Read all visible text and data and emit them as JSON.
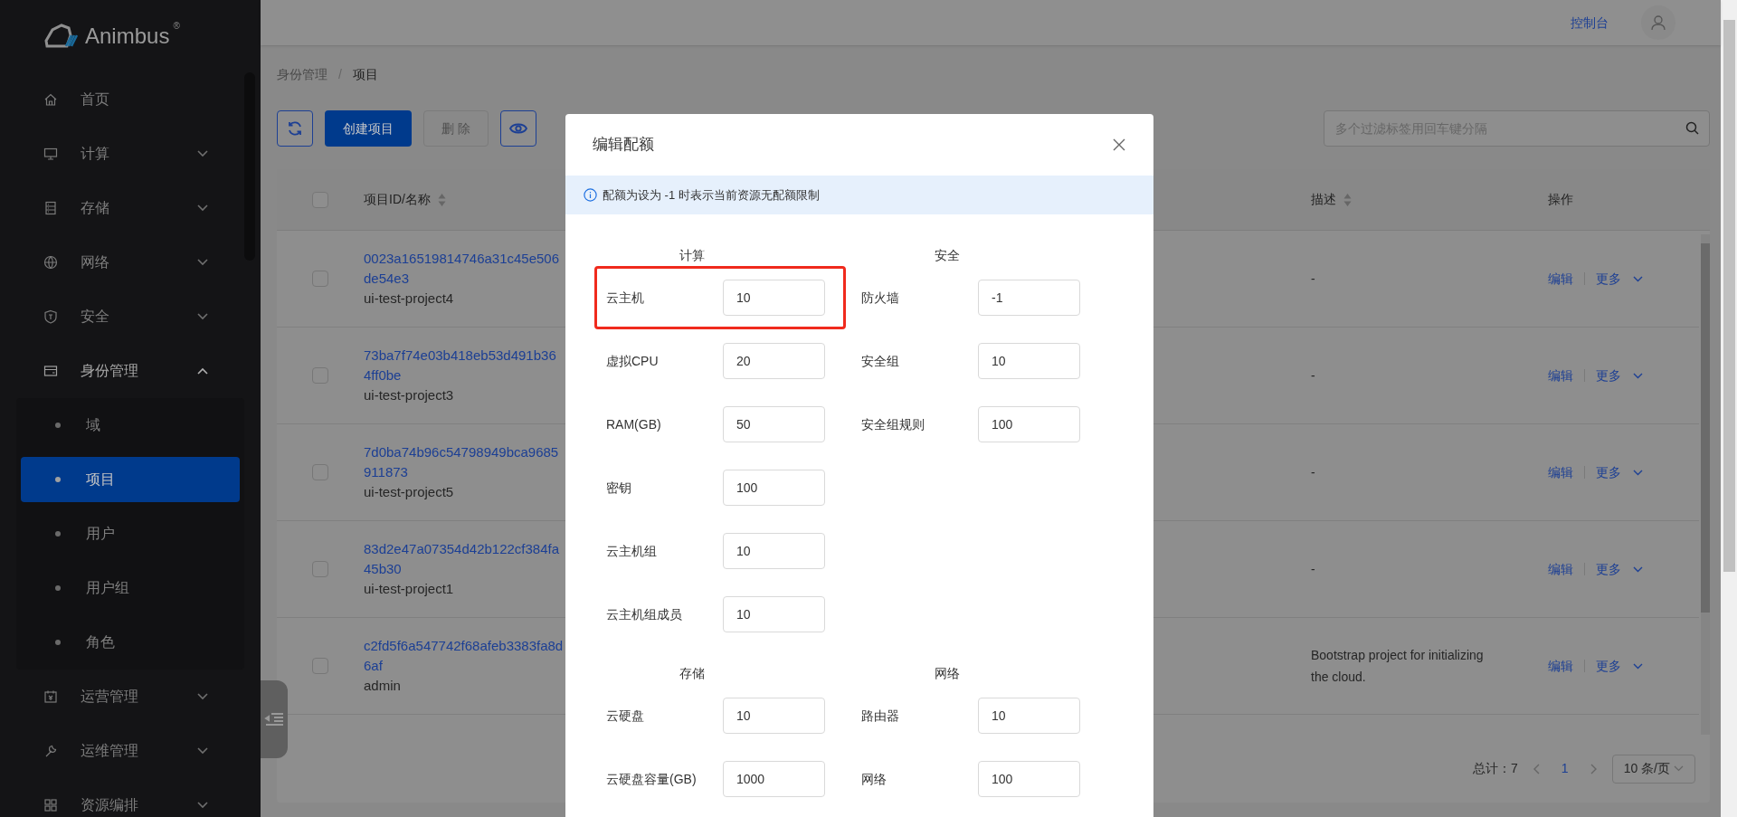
{
  "app": {
    "logo": "Animbus",
    "logo_mark": "®"
  },
  "sidebar": {
    "items": [
      {
        "label": "首页",
        "kind": "link"
      },
      {
        "label": "计算",
        "kind": "group",
        "expanded": false
      },
      {
        "label": "存储",
        "kind": "group",
        "expanded": false
      },
      {
        "label": "网络",
        "kind": "group",
        "expanded": false
      },
      {
        "label": "安全",
        "kind": "group",
        "expanded": false
      },
      {
        "label": "身份管理",
        "kind": "group",
        "expanded": true,
        "children": [
          {
            "label": "域",
            "selected": false
          },
          {
            "label": "项目",
            "selected": true
          },
          {
            "label": "用户",
            "selected": false
          },
          {
            "label": "用户组",
            "selected": false
          },
          {
            "label": "角色",
            "selected": false
          }
        ]
      },
      {
        "label": "运营管理",
        "kind": "group",
        "expanded": false
      },
      {
        "label": "运维管理",
        "kind": "group",
        "expanded": false
      },
      {
        "label": "资源编排",
        "kind": "group",
        "expanded": false
      }
    ]
  },
  "header": {
    "console_link": "控制台"
  },
  "breadcrumb": {
    "separator": "/",
    "items": [
      "身份管理",
      "项目"
    ]
  },
  "toolbar": {
    "create_button": "创建项目",
    "delete_button": {
      "label": "删 除",
      "disabled": true
    },
    "search": {
      "placeholder": "多个过滤标签用回车键分隔"
    }
  },
  "table": {
    "select_all_checked": false,
    "columns": [
      {
        "label": "项目ID/名称",
        "sortable": true
      },
      {
        "label": "描述",
        "sortable": true
      },
      {
        "label": "操作",
        "sortable": false
      }
    ],
    "rows": [
      {
        "checked": false,
        "id": "0023a16519814746a31c45e506de54e3",
        "name": "ui-test-project4",
        "description": "-",
        "actions": [
          "编辑",
          "更多"
        ]
      },
      {
        "checked": false,
        "id": "73ba7f74e03b418eb53d491b364ff0be",
        "name": "ui-test-project3",
        "description": "-",
        "actions": [
          "编辑",
          "更多"
        ]
      },
      {
        "checked": false,
        "id": "7d0ba74b96c54798949bca9685911873",
        "name": "ui-test-project5",
        "description": "-",
        "actions": [
          "编辑",
          "更多"
        ]
      },
      {
        "checked": false,
        "id": "83d2e47a07354d42b122cf384fa45b30",
        "name": "ui-test-project1",
        "description": "-",
        "actions": [
          "编辑",
          "更多"
        ]
      },
      {
        "checked": false,
        "id": "c2fd5f6a547742f68afeb3383fa8d6af",
        "name": "admin",
        "description": "Bootstrap project for initializing the cloud.",
        "actions": [
          "编辑",
          "更多"
        ]
      }
    ]
  },
  "pagination": {
    "total": "总计：7",
    "page": "1",
    "page_size": "10 条/页"
  },
  "modal": {
    "title": "编辑配额",
    "info": "配额为设为 -1 时表示当前资源无配额限制",
    "sections": [
      {
        "title": "计算",
        "fields": [
          {
            "label": "云主机",
            "value": "10",
            "highlighted": true
          },
          {
            "label": "虚拟CPU",
            "value": "20",
            "highlighted": false
          },
          {
            "label": "RAM(GB)",
            "value": "50",
            "highlighted": false
          },
          {
            "label": "密钥",
            "value": "100",
            "highlighted": false
          },
          {
            "label": "云主机组",
            "value": "10",
            "highlighted": false
          },
          {
            "label": "云主机组成员",
            "value": "10",
            "highlighted": false
          }
        ]
      },
      {
        "title": "安全",
        "fields": [
          {
            "label": "防火墙",
            "value": "-1",
            "highlighted": false
          },
          {
            "label": "安全组",
            "value": "10",
            "highlighted": false
          },
          {
            "label": "安全组规则",
            "value": "100",
            "highlighted": false
          }
        ]
      },
      {
        "title": "存储",
        "fields": [
          {
            "label": "云硬盘",
            "value": "10",
            "highlighted": false
          },
          {
            "label": "云硬盘容量(GB)",
            "value": "1000",
            "highlighted": false
          }
        ]
      },
      {
        "title": "网络",
        "fields": [
          {
            "label": "路由器",
            "value": "10",
            "highlighted": false
          },
          {
            "label": "网络",
            "value": "100",
            "highlighted": false
          }
        ]
      }
    ]
  }
}
